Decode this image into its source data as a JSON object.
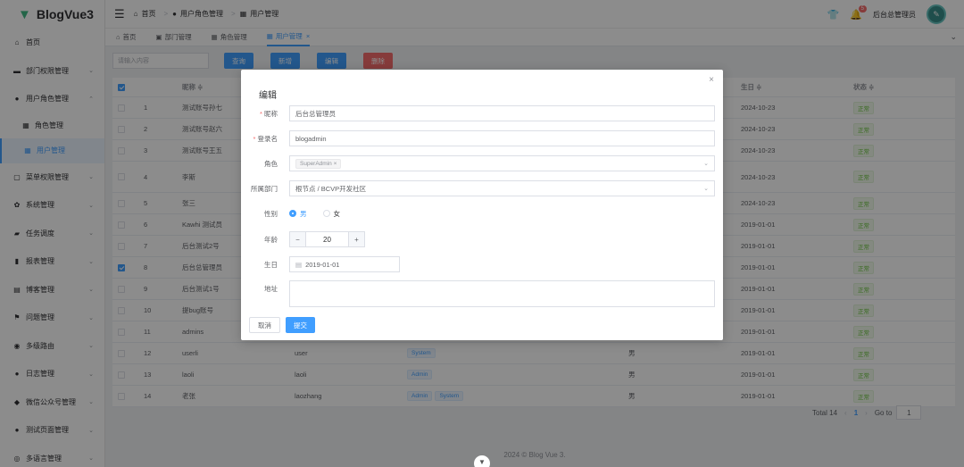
{
  "app": {
    "title": "BlogVue3"
  },
  "sidebar": {
    "items": [
      {
        "icon": "home-icon",
        "label": "首页"
      },
      {
        "icon": "briefcase-icon",
        "label": "部门权限管理",
        "chev": "⌄"
      },
      {
        "icon": "user-icon",
        "label": "用户角色管理",
        "chev": "⌃"
      },
      {
        "icon": "grid-icon",
        "label": "角色管理",
        "sub": true
      },
      {
        "icon": "grid-icon",
        "label": "用户管理",
        "sub": true,
        "active": true
      },
      {
        "icon": "lock-icon",
        "label": "菜单权限管理",
        "chev": "⌄"
      },
      {
        "icon": "gear-icon",
        "label": "系统管理",
        "chev": "⌄"
      },
      {
        "icon": "ticket-icon",
        "label": "任务调度",
        "chev": "⌄"
      },
      {
        "icon": "chart-icon",
        "label": "报表管理",
        "chev": "⌄"
      },
      {
        "icon": "box-icon",
        "label": "博客管理",
        "chev": "⌄"
      },
      {
        "icon": "flag-icon",
        "label": "问题管理",
        "chev": "⌄"
      },
      {
        "icon": "compass-icon",
        "label": "多级路由",
        "chev": "⌄"
      },
      {
        "icon": "user-icon",
        "label": "日志管理",
        "chev": "⌄"
      },
      {
        "icon": "wechat-icon",
        "label": "微信公众号管理",
        "chev": "⌄"
      },
      {
        "icon": "circle-icon",
        "label": "测试页面管理",
        "chev": "⌄"
      },
      {
        "icon": "globe-icon",
        "label": "多语言管理",
        "chev": "⌄"
      }
    ]
  },
  "header": {
    "breadcrumb": [
      "首页",
      "用户角色管理",
      "用户管理"
    ],
    "notify_count": "5",
    "username": "后台总管理员"
  },
  "tabs": [
    {
      "label": "首页"
    },
    {
      "label": "部门管理"
    },
    {
      "label": "角色管理"
    },
    {
      "label": "用户管理",
      "active": true,
      "close": "×"
    }
  ],
  "toolbar": {
    "search_placeholder": "请输入内容",
    "query": "查询",
    "add": "新增",
    "edit": "编辑",
    "delete": "删除"
  },
  "table": {
    "columns": [
      "昵称 ≑",
      "生日 ≑",
      "状态 ≑"
    ],
    "rows": [
      {
        "n": "1",
        "nick": "测试账号孙七",
        "login": "",
        "roles": [],
        "sex": "",
        "birth": "2024-10-23",
        "status": "正常"
      },
      {
        "n": "2",
        "nick": "测试账号赵六",
        "login": "",
        "roles": [],
        "sex": "",
        "birth": "2024-10-23",
        "status": "正常"
      },
      {
        "n": "3",
        "nick": "测试账号王五",
        "login": "",
        "roles": [],
        "sex": "",
        "birth": "2024-10-23",
        "status": "正常"
      },
      {
        "n": "4",
        "nick": "李斯",
        "login": "",
        "roles": [],
        "sex": "",
        "birth": "2024-10-23",
        "status": "正常",
        "tall": true
      },
      {
        "n": "5",
        "nick": "张三",
        "login": "",
        "roles": [],
        "sex": "",
        "birth": "2024-10-23",
        "status": "正常"
      },
      {
        "n": "6",
        "nick": "Kawhi 测试员",
        "login": "",
        "roles": [],
        "sex": "",
        "birth": "2019-01-01",
        "status": "正常"
      },
      {
        "n": "7",
        "nick": "后台测试2号",
        "login": "",
        "roles": [],
        "sex": "",
        "birth": "2019-01-01",
        "status": "正常"
      },
      {
        "n": "8",
        "nick": "后台总管理员",
        "login": "",
        "roles": [],
        "sex": "",
        "birth": "2019-01-01",
        "status": "正常",
        "checked": true
      },
      {
        "n": "9",
        "nick": "后台测试1号",
        "login": "",
        "roles": [],
        "sex": "",
        "birth": "2019-01-01",
        "status": "正常"
      },
      {
        "n": "10",
        "nick": "提bug账号",
        "login": "",
        "roles": [],
        "sex": "",
        "birth": "2019-01-01",
        "status": "正常"
      },
      {
        "n": "11",
        "nick": "admins",
        "login": "",
        "roles": [],
        "sex": "",
        "birth": "2019-01-01",
        "status": "正常"
      },
      {
        "n": "12",
        "nick": "userli",
        "login": "user",
        "roles": [
          "System"
        ],
        "sex": "男",
        "birth": "2019-01-01",
        "status": "正常"
      },
      {
        "n": "13",
        "nick": "laoli",
        "login": "laoli",
        "roles": [
          "Admin"
        ],
        "sex": "男",
        "birth": "2019-01-01",
        "status": "正常"
      },
      {
        "n": "14",
        "nick": "老张",
        "login": "laozhang",
        "roles": [
          "Admin",
          "System"
        ],
        "sex": "男",
        "birth": "2019-01-01",
        "status": "正常"
      }
    ]
  },
  "pagination": {
    "total": "Total 14",
    "prev": "‹",
    "current": "1",
    "next": "›",
    "goto_label": "Go to",
    "goto_value": "1"
  },
  "footer": {
    "text": "2024 © Blog Vue 3."
  },
  "dialog": {
    "title": "编辑",
    "close": "×",
    "fields": {
      "nick": {
        "label": "昵称",
        "value": "后台总管理员"
      },
      "login": {
        "label": "登录名",
        "value": "blogadmin"
      },
      "role": {
        "label": "角色",
        "tag": "SuperAdmin",
        "tag_close": "×"
      },
      "dept": {
        "label": "所属部门",
        "value": "根节点 / BCVP开发社区"
      },
      "sex": {
        "label": "性别",
        "male": "男",
        "female": "女",
        "selected": "男"
      },
      "age": {
        "label": "年龄",
        "value": "20",
        "minus": "−",
        "plus": "+"
      },
      "birth": {
        "label": "生日",
        "value": "2019-01-01"
      },
      "address": {
        "label": "地址",
        "value": ""
      }
    },
    "cancel": "取消",
    "submit": "提交"
  }
}
